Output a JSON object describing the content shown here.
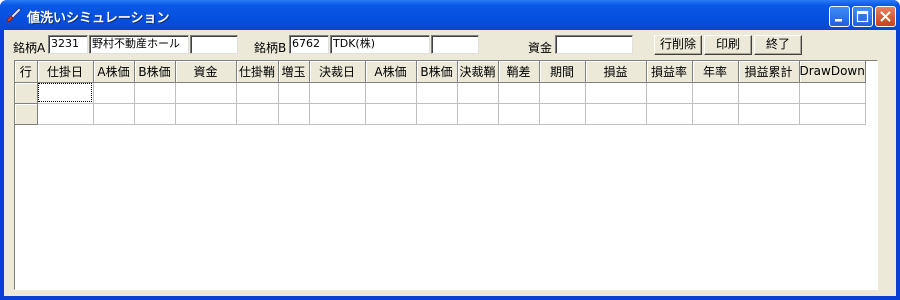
{
  "window": {
    "title": "値洗いシミュレーション"
  },
  "header": {
    "stock_a_label": "銘柄A",
    "stock_a_code": "3231",
    "stock_a_name": "野村不動産ホール",
    "stock_a_extra": "",
    "stock_b_label": "銘柄B",
    "stock_b_code": "6762",
    "stock_b_name": "TDK(株)",
    "stock_b_extra": "",
    "capital_label": "資金",
    "capital_value": "",
    "buttons": {
      "delete_row": "行削除",
      "print": "印刷",
      "exit": "終了"
    }
  },
  "grid": {
    "columns": [
      "行",
      "仕掛日",
      "A株価",
      "B株価",
      "資金",
      "仕掛鞘",
      "増玉",
      "決裁日",
      "A株価",
      "B株価",
      "決裁鞘",
      "鞘差",
      "期間",
      "損益",
      "損益率",
      "年率",
      "損益累計",
      "DrawDown"
    ],
    "rows": [
      [
        "",
        "",
        "",
        "",
        "",
        "",
        "",
        "",
        "",
        "",
        "",
        "",
        "",
        "",
        "",
        "",
        "",
        ""
      ],
      [
        "",
        "",
        "",
        "",
        "",
        "",
        "",
        "",
        "",
        "",
        "",
        "",
        "",
        "",
        "",
        "",
        "",
        ""
      ]
    ]
  },
  "colors": {
    "titlebar": "#0a58e6",
    "face": "#ece9d8",
    "close": "#c8401a"
  },
  "icons": {
    "app": "brush-icon",
    "minimize": "minimize-icon",
    "maximize": "maximize-icon",
    "close": "close-icon"
  }
}
